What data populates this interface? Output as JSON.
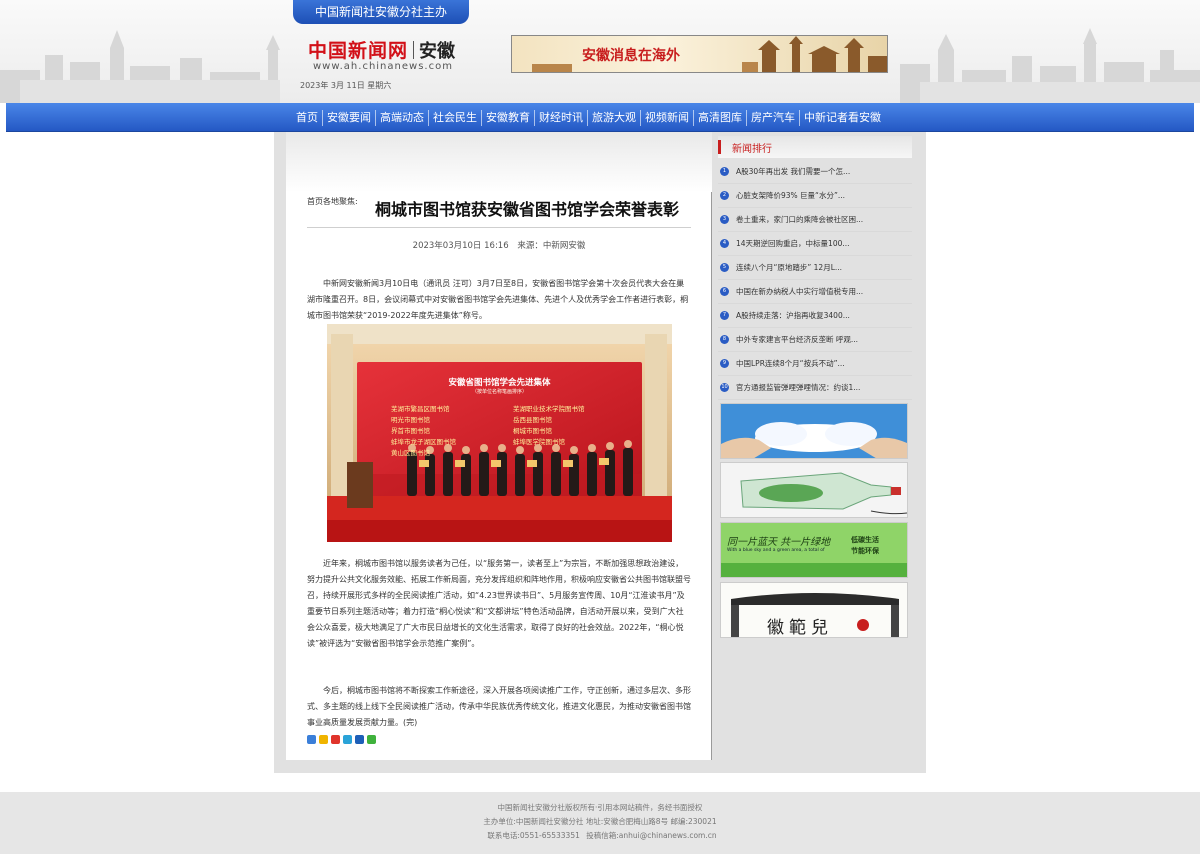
{
  "header": {
    "sponsor": "中国新闻社安徽分社主办",
    "logo_cn": "中国新闻网",
    "logo_region": "安徽",
    "logo_url": "www.ah.chinanews.com",
    "date": "2023年 3月 11日  星期六",
    "banner_text": "安徽消息在海外"
  },
  "nav": {
    "items": [
      "首页",
      "安徽要闻",
      "高端动态",
      "社会民生",
      "安徽教育",
      "财经时讯",
      "旅游大观",
      "视频新闻",
      "高清图库",
      "房产汽车",
      "中新记者看安徽"
    ]
  },
  "article": {
    "breadcrumb": "首页各地聚焦:",
    "title": "桐城市图书馆获安徽省图书馆学会荣誉表彰",
    "datetime": "2023年03月10日 16:16",
    "source": "来源：中新网安徽",
    "paragraphs": [
      "中新网安徽新闻3月10日电（通讯员 汪可）3月7日至8日，安徽省图书馆学会第十次会员代表大会在巢湖市隆重召开。8日，会议闭幕式中对安徽省图书馆学会先进集体、先进个人及优秀学会工作者进行表彰，桐城市图书馆荣获“2019-2022年度先进集体”称号。",
      "近年来，桐城市图书馆以服务读者为己任，以“服务第一，读者至上”为宗旨，不断加强思想政治建设，努力提升公共文化服务效能、拓展工作新局面，充分发挥组织和阵地作用，积极响应安徽省公共图书馆联盟号召，持续开展形式多样的全民阅读推广活动，如“4.23世界读书日”、5月服务宣传周、10月“江淮读书月”及重要节日系列主题活动等；着力打造“桐心悦读”和“文都讲坛”特色活动品牌，自活动开展以来，受到广大社会公众喜爱，极大地满足了广大市民日益增长的文化生活需求，取得了良好的社会效益。2022年，“桐心悦读”被评选为“安徽省图书馆学会示范推广案例”。",
      "今后，桐城市图书馆将不断探索工作新途径，深入开展各项阅读推广工作，守正创新，通过多层次、多形式、多主题的线上线下全民阅读推广活动，传承中华民族优秀传统文化，推进文化惠民，为推动安徽省图书馆事业高质量发展贡献力量。(完)"
    ],
    "photo": {
      "screen_title": "安徽省图书馆学会先进集体",
      "screen_subtitle": "（按单位名称笔画排序）",
      "screen_left": [
        "芜湖市繁昌区图书馆",
        "明光市图书馆",
        "界首市图书馆",
        "蚌埠市龙子湖区图书馆",
        "黄山区图书馆"
      ],
      "screen_right": [
        "芜湖职业技术学院图书馆",
        "岳西县图书馆",
        "桐城市图书馆",
        "蚌埠医学院图书馆"
      ]
    }
  },
  "sidebar": {
    "rank_title": "新闻排行",
    "rank_items": [
      "A股30年再出发 我们需要一个怎...",
      "心脏支架降价93% 巨量“水分”...",
      "卷土重来，家门口的乘降会被社区困...",
      "14天期逆回购重启，中标量100...",
      "连续八个月“原地踏步” 12月L...",
      "中国在新办纳税人中实行增值税专用...",
      "A股持续走落：沪指再收复3400...",
      "中外专家建言平台经济反垄断 呼观...",
      "中国LPR连续8个月“按兵不动”...",
      "官方通报监管弹哩弹哩情况：约谈1..."
    ],
    "ad3_text_left": "同一片蓝天 共一片绿地",
    "ad3_text_en": "With a blue sky and a green area, a total of",
    "ad3_text_right1": "低碳生活",
    "ad3_text_right2": "节能环保",
    "ad4_text": "徽範兒"
  },
  "footer": {
    "line1": "中国新闻社安徽分社版权所有·引用本网站稿件，务经书面授权",
    "line2": "主办单位:中国新闻社安徽分社 地址:安徽合肥梅山路8号 邮编:230021",
    "phone": "联系电话:0551-65533351",
    "email": "投稿信箱:anhui@chinanews.com.cn"
  },
  "colors": {
    "nav_blue": "#2458c4",
    "accent_red": "#c81e1e",
    "shell_grey": "#e1e1e1"
  }
}
